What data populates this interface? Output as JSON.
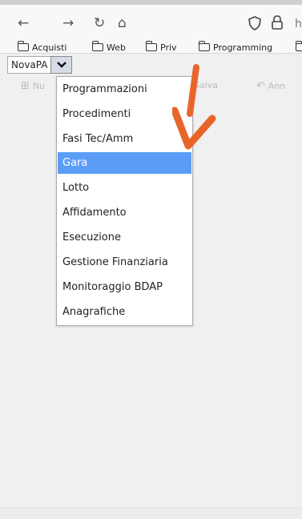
{
  "browser": {
    "nav": {
      "back": "←",
      "forward": "→",
      "reload": "↻",
      "home": "⌂"
    },
    "url_partial": "h",
    "bookmarks": [
      "Acquisti",
      "Web",
      "Priv",
      "Programming"
    ]
  },
  "app": {
    "module_select": {
      "value": "NovaPA"
    },
    "toolbar": {
      "new_label": "Nu",
      "save_label": "Salva",
      "cancel_label": "Ann"
    },
    "menu": {
      "items": [
        "Programmazioni",
        "Procedimenti",
        "Fasi Tec/Amm",
        "Gara",
        "Lotto",
        "Affidamento",
        "Esecuzione",
        "Gestione Finanziaria",
        "Monitoraggio BDAP",
        "Anagrafiche"
      ],
      "selected": "Gara",
      "selected_color": "#5b9df6"
    }
  },
  "annotation": {
    "arrow_color": "#e8652a"
  }
}
